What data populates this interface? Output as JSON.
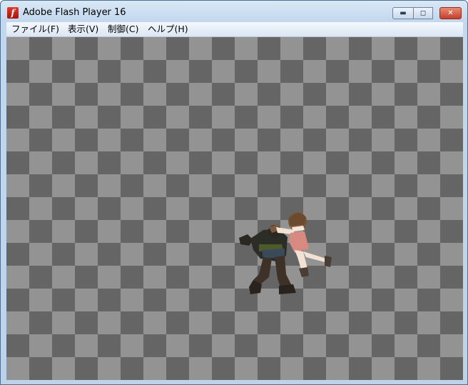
{
  "window": {
    "title": "Adobe Flash Player 16",
    "icon": "flash-player-icon",
    "controls": {
      "minimize_icon": "minimize-icon",
      "maximize_icon": "maximize-icon",
      "close_icon": "close-icon"
    }
  },
  "menu": {
    "items": [
      {
        "label": "ファイル(F)"
      },
      {
        "label": "表示(V)"
      },
      {
        "label": "制御(C)"
      },
      {
        "label": "ヘルプ(H)"
      }
    ]
  },
  "stage": {
    "background": "checkerboard",
    "light_color": "#939393",
    "dark_color": "#656565",
    "content": "game-sprites-character-grapple"
  }
}
